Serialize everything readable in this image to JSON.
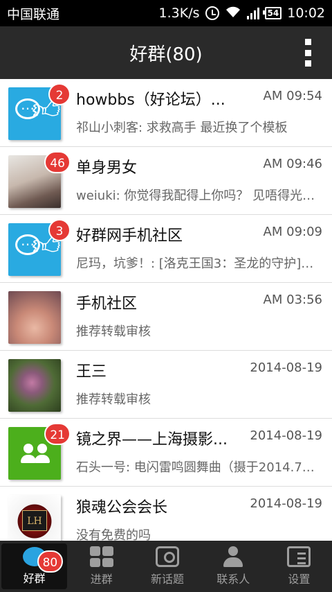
{
  "status_bar": {
    "carrier": "中国联通",
    "speed": "1.3K/s",
    "battery": "54",
    "time": "10:02"
  },
  "header": {
    "title": "好群(80)"
  },
  "groups": [
    {
      "title": "howbbs（好论坛）...",
      "time": "AM 09:54",
      "preview": "祁山小刺客: 求救高手 最近换了个模板",
      "badge": "2",
      "avatar": "chat-thumb-icon"
    },
    {
      "title": "单身男女",
      "time": "AM 09:46",
      "preview": "weiuki: 你觉得我配得上你吗？ 见唔得光…",
      "badge": "46",
      "avatar": "photo"
    },
    {
      "title": "好群网手机社区",
      "time": "AM 09:09",
      "preview": "尼玛，坑爹！: [洛克王国3：圣龙的守护]…",
      "badge": "3",
      "avatar": "chat-thumb-icon"
    },
    {
      "title": "手机社区",
      "time": "AM 03:56",
      "preview": "推荐转载审核",
      "badge": "",
      "avatar": "photo"
    },
    {
      "title": "王三",
      "time": "2014-08-19",
      "preview": "推荐转载审核",
      "badge": "",
      "avatar": "photo"
    },
    {
      "title": "镜之界——上海摄影...",
      "time": "2014-08-19",
      "preview": "石头一号: 电闪雷鸣圆舞曲（摄于2014.7…",
      "badge": "21",
      "avatar": "people-icon"
    },
    {
      "title": "狼魂公会会长",
      "time": "2014-08-19",
      "preview": "没有免费的吗",
      "badge": "",
      "avatar": "emblem"
    }
  ],
  "avatar_emblem_text": "LH",
  "tabs": [
    {
      "label": "好群",
      "badge": "80",
      "icon": "chat-icon"
    },
    {
      "label": "进群",
      "icon": "grid-icon"
    },
    {
      "label": "新话题",
      "icon": "camera-icon"
    },
    {
      "label": "联系人",
      "icon": "person-icon"
    },
    {
      "label": "设置",
      "icon": "settings-icon"
    }
  ],
  "colors": {
    "header_bg": "#2a2a2a",
    "badge": "#e53935",
    "avatar_blue": "#29aae1",
    "avatar_green": "#4caf1c",
    "tab_active_icon": "#2aa3e0"
  }
}
